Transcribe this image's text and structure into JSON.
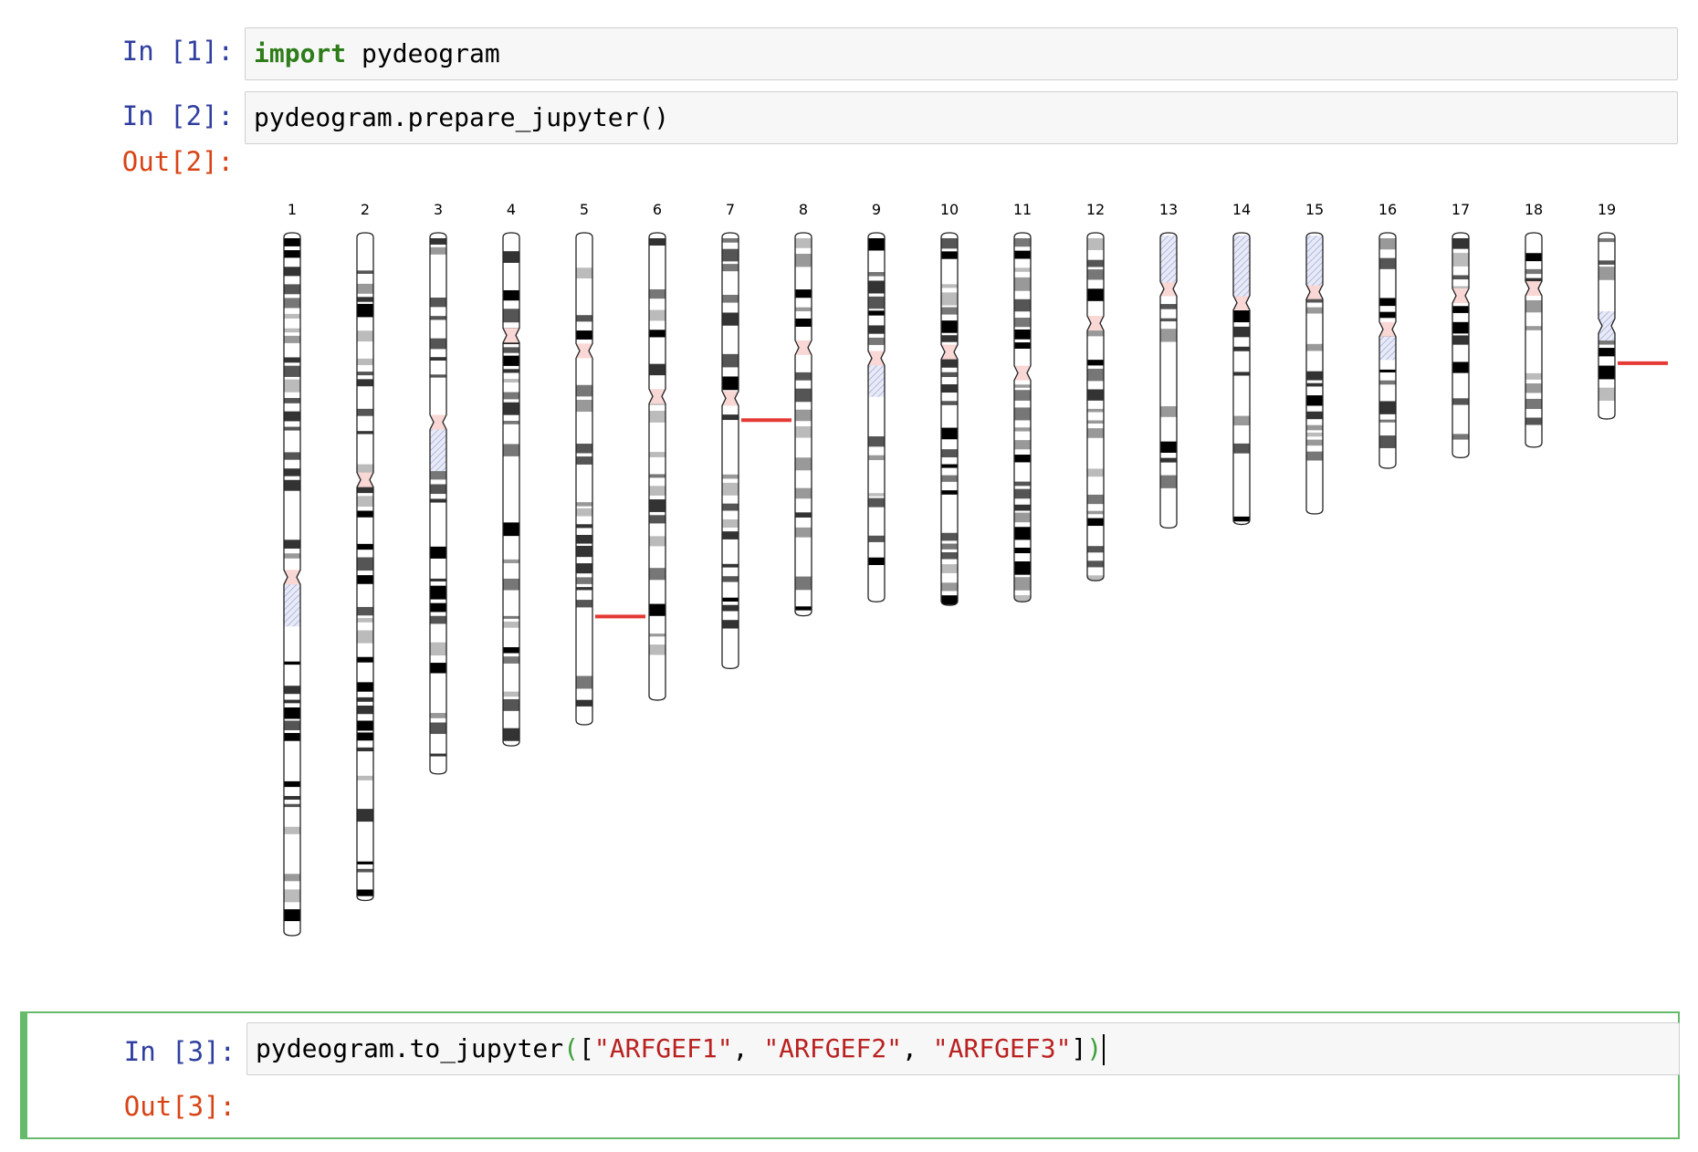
{
  "cells": [
    {
      "prompt": "In [1]:",
      "code": [
        {
          "text": "import",
          "style": "kw"
        },
        {
          "text": " pydeogram",
          "style": ""
        }
      ]
    },
    {
      "prompt": "In [2]:",
      "code": [
        {
          "text": "pydeogram.prepare_jupyter()",
          "style": ""
        }
      ],
      "output_prompt": "Out[2]:"
    },
    {
      "prompt": "In [3]:",
      "code": [
        {
          "text": "pydeogram.to_jupyter",
          "style": ""
        },
        {
          "text": "(",
          "style": "paren-hl"
        },
        {
          "text": "[",
          "style": ""
        },
        {
          "text": "\"ARFGEF1\"",
          "style": "str"
        },
        {
          "text": ", ",
          "style": ""
        },
        {
          "text": "\"ARFGEF2\"",
          "style": "str"
        },
        {
          "text": ", ",
          "style": ""
        },
        {
          "text": "\"ARFGEF3\"",
          "style": "str"
        },
        {
          "text": "]",
          "style": ""
        },
        {
          "text": ")",
          "style": "paren-hl"
        }
      ],
      "output_prompt": "Out[3]:",
      "selected": true
    }
  ],
  "ideogram": {
    "chromosomes": [
      "1",
      "2",
      "3",
      "4",
      "5",
      "6",
      "7",
      "8",
      "9",
      "10",
      "11",
      "12",
      "13",
      "14",
      "15",
      "16",
      "17",
      "18",
      "19"
    ],
    "relative_lengths": [
      1.0,
      0.95,
      0.77,
      0.73,
      0.7,
      0.665,
      0.62,
      0.545,
      0.525,
      0.53,
      0.525,
      0.495,
      0.42,
      0.415,
      0.4,
      0.335,
      0.32,
      0.305,
      0.265
    ],
    "centromere_fraction": [
      0.49,
      0.37,
      0.35,
      0.2,
      0.24,
      0.35,
      0.38,
      0.3,
      0.34,
      0.32,
      0.38,
      0.26,
      0.19,
      0.24,
      0.21,
      0.41,
      0.28,
      0.26,
      0.5
    ],
    "markers": [
      {
        "chromosome": "5",
        "position_fraction": 0.78,
        "side": "right"
      },
      {
        "chromosome": "7",
        "position_fraction": 0.43,
        "side": "right"
      },
      {
        "chromosome": "19",
        "position_fraction": 0.7,
        "side": "right"
      }
    ],
    "marker_color": "#e53935",
    "centromere_color": "#f8d7d4",
    "heterochromatin_color": "#9fa8da"
  }
}
